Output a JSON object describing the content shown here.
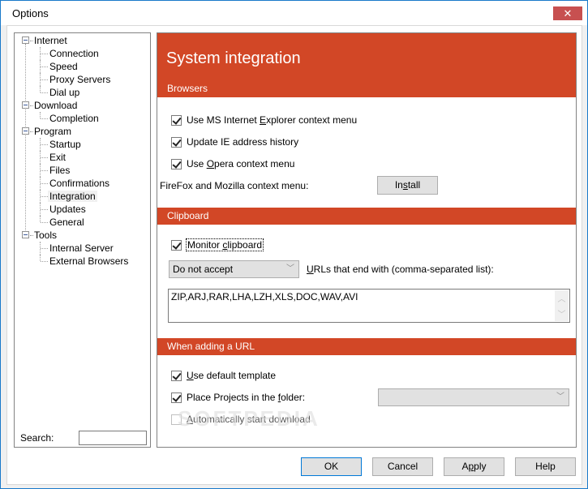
{
  "window": {
    "title": "Options",
    "close_icon": "close-icon"
  },
  "tree": {
    "nodes": [
      {
        "label": "Internet",
        "level": 0,
        "expanded": true
      },
      {
        "label": "Connection",
        "level": 1
      },
      {
        "label": "Speed",
        "level": 1
      },
      {
        "label": "Proxy Servers",
        "level": 1
      },
      {
        "label": "Dial up",
        "level": 1
      },
      {
        "label": "Download",
        "level": 0,
        "expanded": true
      },
      {
        "label": "Completion",
        "level": 1
      },
      {
        "label": "Program",
        "level": 0,
        "expanded": true
      },
      {
        "label": "Startup",
        "level": 1
      },
      {
        "label": "Exit",
        "level": 1
      },
      {
        "label": "Files",
        "level": 1
      },
      {
        "label": "Confirmations",
        "level": 1
      },
      {
        "label": "Integration",
        "level": 1,
        "selected": true
      },
      {
        "label": "Updates",
        "level": 1
      },
      {
        "label": "General",
        "level": 1
      },
      {
        "label": "Tools",
        "level": 0,
        "expanded": true
      },
      {
        "label": "Internal Server",
        "level": 1
      },
      {
        "label": "External Browsers",
        "level": 1
      }
    ],
    "search_label": "Search:",
    "search_value": ""
  },
  "panel": {
    "title": "System integration",
    "accent_color": "#d24726",
    "browsers": {
      "header": "Browsers",
      "ie_context_menu": {
        "pre": "Use MS Internet ",
        "ul": "E",
        "post": "xplorer context menu",
        "checked": true
      },
      "ie_history": {
        "pre": "Update IE address history",
        "ul": "",
        "post": "",
        "checked": true
      },
      "opera_context_menu": {
        "pre": "Use ",
        "ul": "O",
        "post": "pera context menu",
        "checked": true
      },
      "firefox_label": "FireFox and Mozilla context menu:",
      "install_button": {
        "pre": "In",
        "ul": "s",
        "post": "tall"
      }
    },
    "clipboard": {
      "header": "Clipboard",
      "monitor": {
        "pre": "Monitor ",
        "ul": "c",
        "post": "lipboard",
        "checked": true
      },
      "accept_select": "Do not accept",
      "urls_label": {
        "pre": "",
        "ul": "U",
        "post": "RLs that end with (comma-separated list):"
      },
      "extensions": "ZIP,ARJ,RAR,LHA,LZH,XLS,DOC,WAV,AVI"
    },
    "adding_url": {
      "header": "When adding a URL",
      "default_template": {
        "pre": "",
        "ul": "U",
        "post": "se default template",
        "checked": true
      },
      "place_projects": {
        "pre": "Place Projects in the ",
        "ul": "f",
        "post": "older:",
        "checked": true
      },
      "folder_select": "",
      "auto_start": {
        "pre": "",
        "ul": "A",
        "post": "utomatically start download",
        "checked": false
      }
    }
  },
  "footer": {
    "ok": "OK",
    "cancel": "Cancel",
    "apply": {
      "pre": "A",
      "ul": "p",
      "post": "ply"
    },
    "help": "Help"
  },
  "watermark": "SOFTPEDIA"
}
